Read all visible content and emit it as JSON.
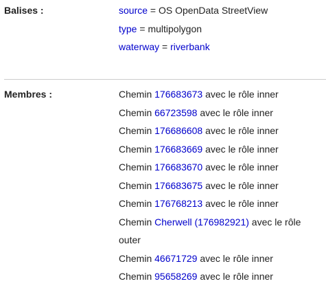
{
  "tags": {
    "label": "Balises :",
    "items": [
      {
        "key": "source",
        "eq": " = ",
        "value": "OS OpenData StreetView",
        "value_link": false
      },
      {
        "key": "type",
        "eq": " = ",
        "value": "multipolygon",
        "value_link": false
      },
      {
        "key": "waterway",
        "eq": " = ",
        "value": "riverbank",
        "value_link": true
      }
    ]
  },
  "members": {
    "label": "Membres :",
    "items": [
      {
        "prefix": "Chemin ",
        "link": "176683673",
        "suffix": " avec le rôle inner"
      },
      {
        "prefix": "Chemin ",
        "link": "66723598",
        "suffix": " avec le rôle inner"
      },
      {
        "prefix": "Chemin ",
        "link": "176686608",
        "suffix": " avec le rôle inner"
      },
      {
        "prefix": "Chemin ",
        "link": "176683669",
        "suffix": " avec le rôle inner"
      },
      {
        "prefix": "Chemin ",
        "link": "176683670",
        "suffix": " avec le rôle inner"
      },
      {
        "prefix": "Chemin ",
        "link": "176683675",
        "suffix": " avec le rôle inner"
      },
      {
        "prefix": "Chemin ",
        "link": "176768213",
        "suffix": " avec le rôle inner"
      },
      {
        "prefix": "Chemin ",
        "link": "Cherwell (176982921)",
        "suffix": " avec le rôle outer"
      },
      {
        "prefix": "Chemin ",
        "link": "46671729",
        "suffix": " avec le rôle inner"
      },
      {
        "prefix": "Chemin ",
        "link": "95658269",
        "suffix": " avec le rôle inner"
      }
    ]
  },
  "colors": {
    "link": "#0000cc",
    "text": "#222222",
    "divider": "#cccccc"
  }
}
